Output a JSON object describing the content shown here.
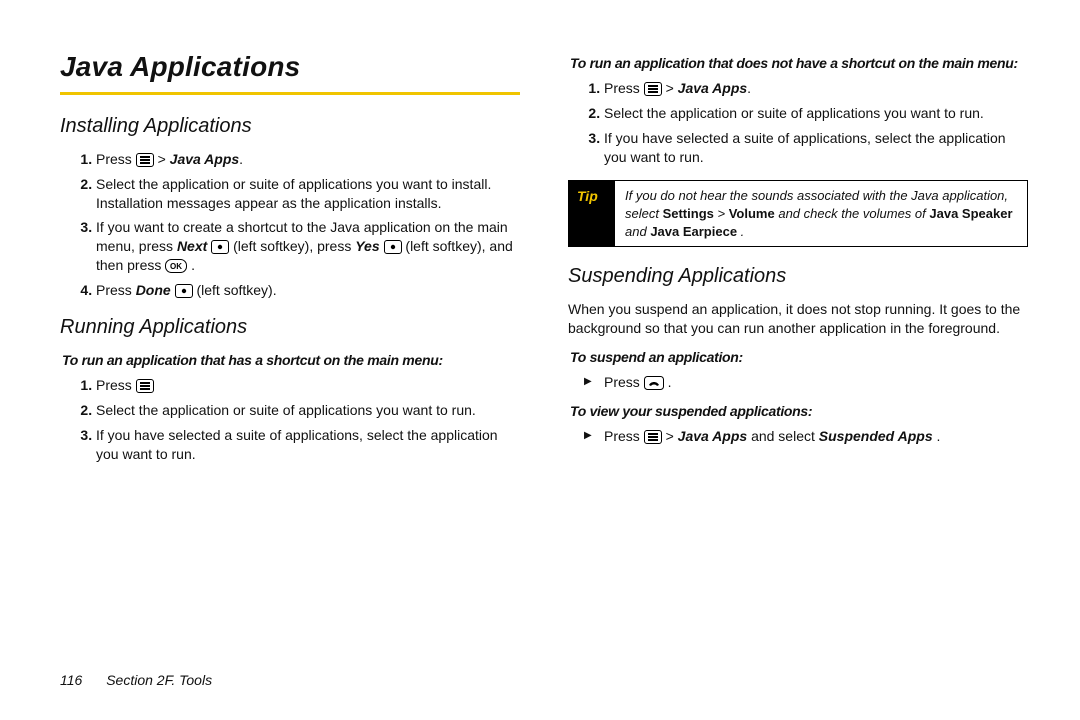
{
  "title": "Java Applications",
  "footer": {
    "pageNumber": "116",
    "section": "Section 2F. Tools"
  },
  "left": {
    "h_installing": "Installing Applications",
    "install": {
      "s1_pre": "Press ",
      "s1_post": " >",
      "s1_target": "Java Apps",
      "s2": "Select the application or suite of applications you want to install. Installation messages appear as the application installs.",
      "s3_a": "If you want to create a shortcut to the Java application on the main menu, press ",
      "s3_next": "Next",
      "s3_b": " (left softkey), press ",
      "s3_yes": "Yes",
      "s3_c": " (left softkey), and then press ",
      "s3_d": ".",
      "s4_a": "Press ",
      "s4_done": "Done",
      "s4_b": " (left softkey)."
    },
    "h_running": "Running Applications",
    "run_shortcut_intro": "To run an application that has a shortcut on the main menu:",
    "run_shortcut": {
      "s1_pre": "Press ",
      "s2": "Select the application or suite of applications you want to run.",
      "s3": "If you have selected a suite of applications, select the application you want to run."
    }
  },
  "right": {
    "run_noshortcut_intro": "To run an application that does not have a shortcut on the main menu:",
    "run_noshortcut": {
      "s1_pre": "Press ",
      "s1_post": " >",
      "s1_target": "Java Apps",
      "s2": "Select the application or suite of applications you want to run.",
      "s3": "If you have selected a suite of applications, select the application you want to run."
    },
    "tip": {
      "label": "Tip",
      "t1": "If you do not hear the sounds associated with the Java application, select ",
      "t_settings": "Settings",
      "t_gt1": " > ",
      "t_volume": "Volume",
      "t2": " and check the volumes of ",
      "t_js": "Java Speaker",
      "t_and": " and ",
      "t_je": "Java Earpiece",
      "t3": "."
    },
    "h_suspending": "Suspending Applications",
    "suspend_body": "When you suspend an application, it does not stop running. It goes to the background so that you can run another application in the foreground.",
    "suspend_intro": "To suspend an application:",
    "suspend_step_pre": "Press ",
    "suspend_step_post": ".",
    "view_intro": "To view your suspended applications:",
    "view_step_pre": "Press ",
    "view_step_mid": " >",
    "view_step_ja": "Java Apps",
    "view_step_and": " and select ",
    "view_step_sa": "Suspended Apps",
    "view_step_post": "."
  }
}
